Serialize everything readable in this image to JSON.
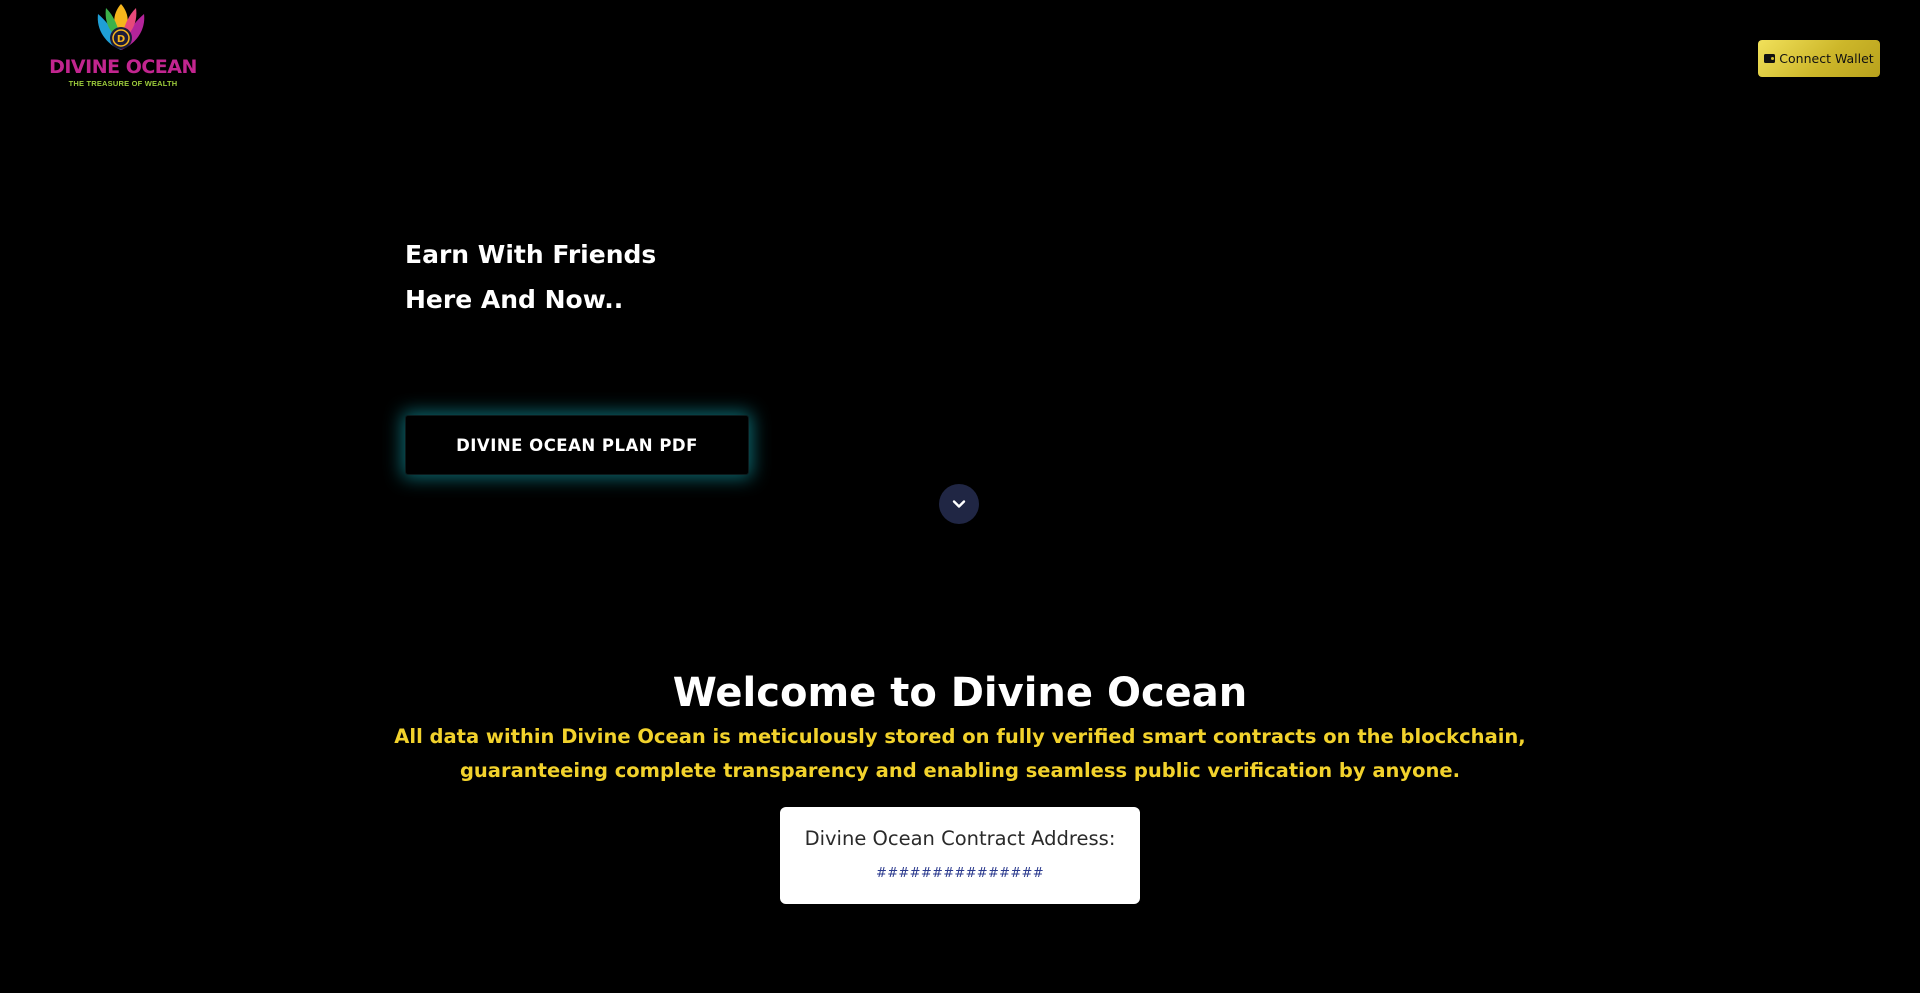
{
  "header": {
    "logo": {
      "title": "DIVINE OCEAN",
      "tagline": "THE TREASURE OF WEALTH",
      "icon": "lotus-logo-icon"
    },
    "connect_wallet": {
      "label": "Connect Wallet",
      "icon": "wallet-icon"
    }
  },
  "hero": {
    "line1": "Earn With Friends",
    "line2": "Here And Now..",
    "plan_button": "DIVINE OCEAN PLAN PDF",
    "scroll_icon": "chevron-down-icon"
  },
  "welcome": {
    "title": "Welcome to Divine Ocean",
    "description": "All data within Divine Ocean is meticulously stored on fully verified smart contracts on the blockchain, guaranteeing complete transparency and enabling seamless public verification by anyone.",
    "contract_label": "Divine Ocean Contract Address:",
    "contract_address": "###############"
  },
  "colors": {
    "background": "#000000",
    "accent_yellow": "#f2d22c",
    "logo_magenta": "#c2258f",
    "logo_green": "#9ccb3b",
    "glow_teal": "#12a0aa",
    "wallet_gold": "#d4c02b",
    "address_blue": "#2b3a8e"
  }
}
